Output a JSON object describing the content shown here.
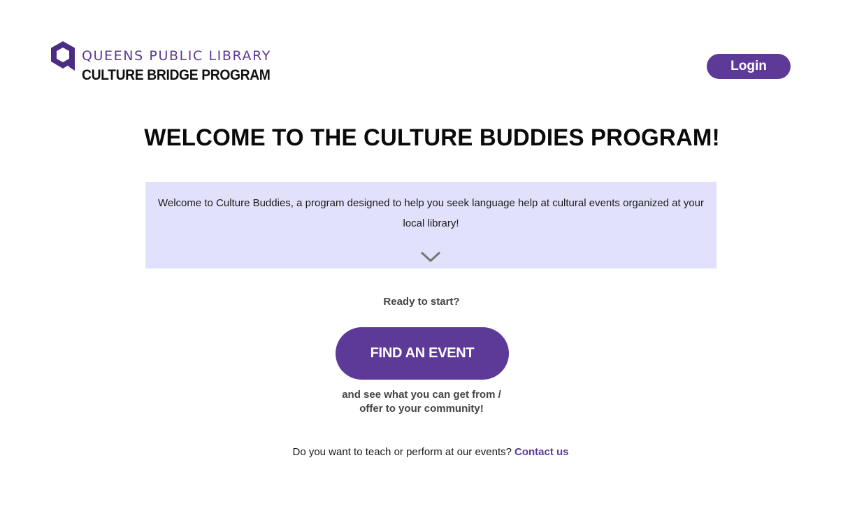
{
  "header": {
    "logo_line1": "QUEENS PUBLIC LIBRARY",
    "logo_line2": "CULTURE BRIDGE PROGRAM",
    "logo_icon": "library-q-logo",
    "login_label": "Login"
  },
  "main": {
    "title": "WELCOME TO THE CULTURE BUDDIES PROGRAM!",
    "intro": "Welcome to Culture Buddies, a program designed to help you seek language help at cultural events organized at your local library!",
    "expand_icon": "chevron-down-icon",
    "ready_text": "Ready to start?",
    "find_event_label": "FIND AN EVENT",
    "subtext_line1": "and see what you can get from /",
    "subtext_line2": "offer to your community!",
    "contact_prompt": "Do you want to teach or perform at our events?",
    "contact_link": "Contact us"
  },
  "colors": {
    "brand_purple": "#5d3a98",
    "intro_bg": "#e2e1fc",
    "secondary_text": "#444444"
  }
}
